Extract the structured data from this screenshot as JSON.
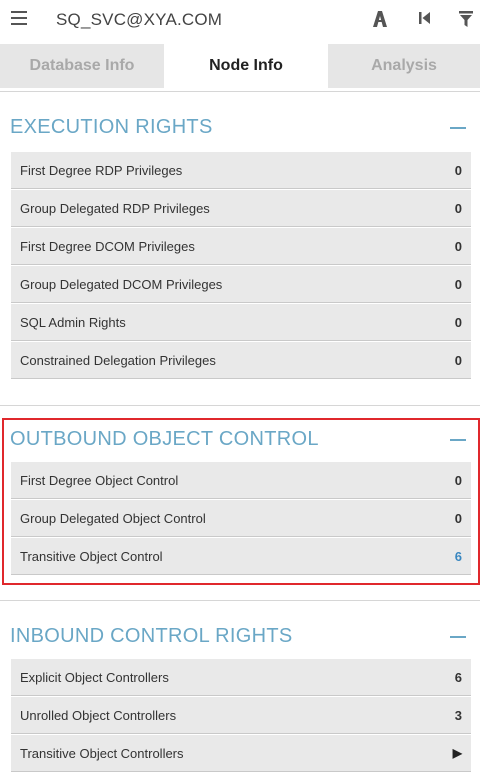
{
  "header": {
    "node_name": "SQ_SVC@XYA.COM",
    "icons": [
      "menu-icon",
      "path-icon",
      "back-icon",
      "filter-icon"
    ]
  },
  "tabs": [
    {
      "label": "Database Info",
      "active": false
    },
    {
      "label": "Node Info",
      "active": true
    },
    {
      "label": "Analysis",
      "active": false
    }
  ],
  "sections": {
    "execution": {
      "title": "EXECUTION RIGHTS",
      "rows": [
        {
          "label": "First Degree RDP Privileges",
          "value": "0"
        },
        {
          "label": "Group Delegated RDP Privileges",
          "value": "0"
        },
        {
          "label": "First Degree DCOM Privileges",
          "value": "0"
        },
        {
          "label": "Group Delegated DCOM Privileges",
          "value": "0"
        },
        {
          "label": "SQL Admin Rights",
          "value": "0"
        },
        {
          "label": "Constrained Delegation Privileges",
          "value": "0"
        }
      ]
    },
    "outbound": {
      "title": "OUTBOUND OBJECT CONTROL",
      "rows": [
        {
          "label": "First Degree Object Control",
          "value": "0"
        },
        {
          "label": "Group Delegated Object Control",
          "value": "0"
        },
        {
          "label": "Transitive Object Control",
          "value": "6"
        }
      ]
    },
    "inbound": {
      "title": "INBOUND CONTROL RIGHTS",
      "rows": [
        {
          "label": "Explicit Object Controllers",
          "value": "6"
        },
        {
          "label": "Unrolled Object Controllers",
          "value": "3"
        },
        {
          "label": "Transitive Object Controllers",
          "value": "▶"
        }
      ]
    }
  },
  "colors": {
    "section_title": "#6aa7c6",
    "link_value": "#3a87c0",
    "highlight_border": "#e0282c"
  }
}
